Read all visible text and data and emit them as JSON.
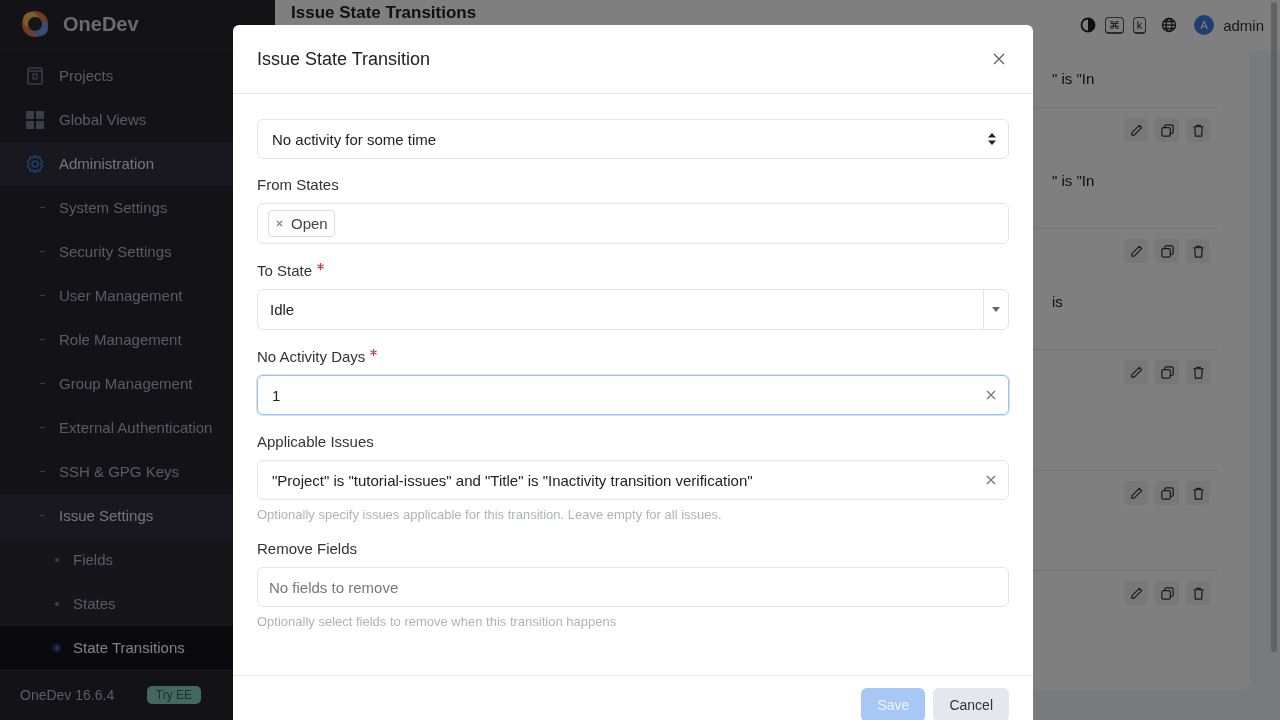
{
  "sidebar": {
    "brand": "OneDev",
    "items": [
      {
        "label": "Projects",
        "selected": false
      },
      {
        "label": "Global Views",
        "selected": false
      },
      {
        "label": "Administration",
        "selected": false,
        "expanded": true,
        "children": [
          {
            "label": "System Settings",
            "selected": false
          },
          {
            "label": "Security Settings",
            "selected": false
          },
          {
            "label": "User Management",
            "selected": false
          },
          {
            "label": "Role Management",
            "selected": false
          },
          {
            "label": "Group Management",
            "selected": false
          },
          {
            "label": "External Authentication",
            "selected": false
          },
          {
            "label": "SSH & GPG Keys",
            "selected": false
          },
          {
            "label": "Issue Settings",
            "selected": false,
            "expanded": true,
            "children": [
              {
                "label": "Fields",
                "selected": false
              },
              {
                "label": "States",
                "selected": false
              },
              {
                "label": "State Transitions",
                "selected": true
              }
            ]
          }
        ]
      }
    ],
    "version": "OneDev 16.6.4",
    "badge": "Try EE"
  },
  "topbar": {
    "title": "Issue State Transitions",
    "shortcut_keys": [
      "⌘",
      "k"
    ],
    "user_initial": "A",
    "user": "admin"
  },
  "transitions": [
    {
      "snippet": "\" is \"In",
      "actions": false
    },
    {
      "snippet": "\" is \"In",
      "actions": true
    },
    {
      "snippet": "is",
      "actions": true
    },
    {
      "actions": true
    },
    {
      "actions": true
    },
    {
      "actions": true
    }
  ],
  "dialog": {
    "title": "Issue State Transition",
    "trigger": "No activity for some time",
    "fields": [
      {
        "kind": "tags",
        "label": "From States",
        "required": false,
        "tags": [
          "Open"
        ]
      },
      {
        "kind": "select",
        "label": "To State",
        "required": true,
        "value": "Idle"
      },
      {
        "kind": "text",
        "label": "No Activity Days",
        "required": true,
        "value": "1",
        "focused": true,
        "clearable": true
      },
      {
        "kind": "text",
        "label": "Applicable Issues",
        "required": false,
        "value": "\"Project\" is \"tutorial-issues\" and \"Title\" is \"Inactivity transition verification\"",
        "clearable": true,
        "help": "Optionally specify issues applicable for this transition. Leave empty for all issues."
      },
      {
        "kind": "text",
        "label": "Remove Fields",
        "required": false,
        "placeholder": "No fields to remove",
        "help": "Optionally select fields to remove when this transition happens"
      }
    ],
    "buttons": [
      {
        "label": "Save",
        "kind": "primary",
        "disabled": true
      },
      {
        "label": "Cancel",
        "kind": "secondary",
        "disabled": false
      }
    ]
  }
}
